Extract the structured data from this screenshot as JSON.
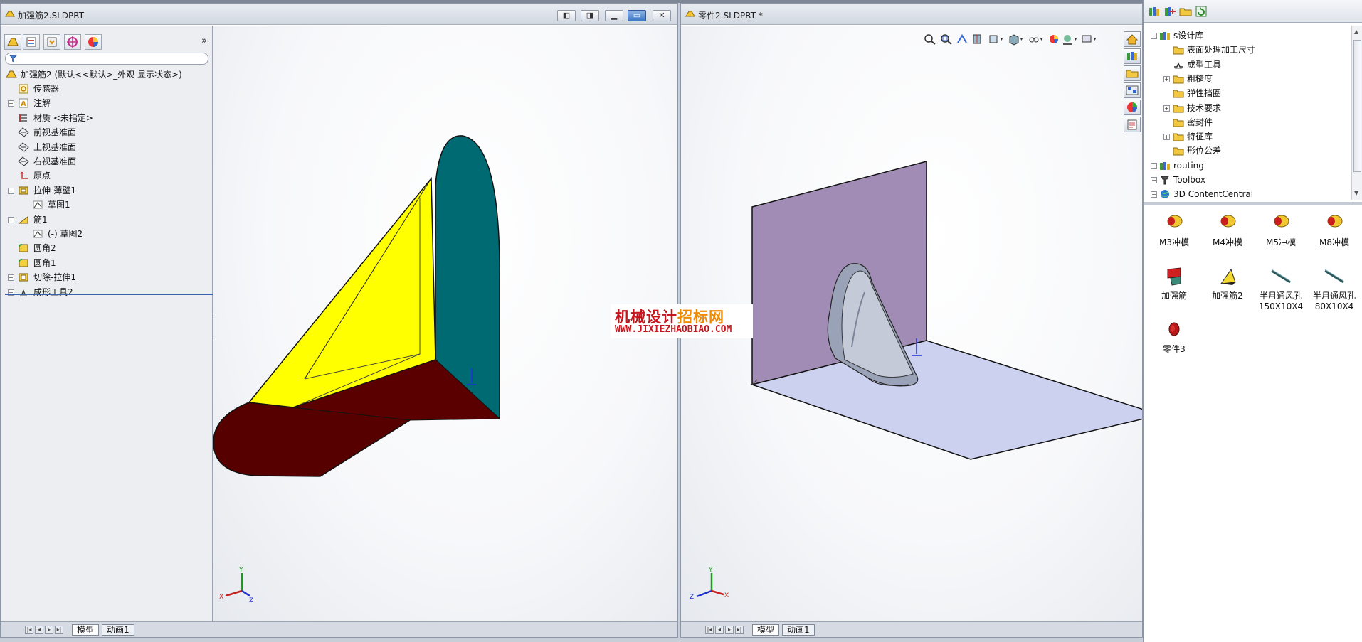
{
  "left_window": {
    "title": "加强筋2.SLDPRT",
    "feature_tree": {
      "root": "加强筋2 (默认<<默认>_外观 显示状态>)",
      "items": [
        {
          "label": "传感器",
          "icon": "sensor-icon",
          "expand": ""
        },
        {
          "label": "注解",
          "icon": "annotation-icon",
          "expand": "+"
        },
        {
          "label": "材质 <未指定>",
          "icon": "material-icon",
          "expand": ""
        },
        {
          "label": "前视基准面",
          "icon": "plane-icon",
          "expand": ""
        },
        {
          "label": "上视基准面",
          "icon": "plane-icon",
          "expand": ""
        },
        {
          "label": "右视基准面",
          "icon": "plane-icon",
          "expand": ""
        },
        {
          "label": "原点",
          "icon": "origin-icon",
          "expand": ""
        },
        {
          "label": "拉伸-薄壁1",
          "icon": "extrude-icon",
          "expand": "-"
        },
        {
          "label": "草图1",
          "icon": "sketch-icon",
          "expand": ""
        },
        {
          "label": "筋1",
          "icon": "rib-icon",
          "expand": "-"
        },
        {
          "label": "(-) 草图2",
          "icon": "sketch-icon",
          "expand": ""
        },
        {
          "label": "圆角2",
          "icon": "fillet-icon",
          "expand": ""
        },
        {
          "label": "圆角1",
          "icon": "fillet-icon",
          "expand": ""
        },
        {
          "label": "切除-拉伸1",
          "icon": "cut-icon",
          "expand": "+"
        },
        {
          "label": "成形工具2",
          "icon": "forming-tool-icon",
          "expand": "+"
        }
      ]
    },
    "tabs": [
      "模型",
      "动画1"
    ]
  },
  "right_window": {
    "title": "零件2.SLDPRT *",
    "tabs": [
      "模型",
      "动画1"
    ]
  },
  "task_pane": {
    "tree": [
      {
        "label": "s设计库",
        "icon": "design-library-icon",
        "expand": "-"
      },
      {
        "label": "表面处理加工尺寸",
        "icon": "folder-icon",
        "expand": ""
      },
      {
        "label": "成型工具",
        "icon": "forming-tool-icon",
        "expand": ""
      },
      {
        "label": "粗糙度",
        "icon": "folder-icon",
        "expand": "+"
      },
      {
        "label": "弹性挡圈",
        "icon": "folder-icon",
        "expand": ""
      },
      {
        "label": "技术要求",
        "icon": "folder-icon",
        "expand": "+"
      },
      {
        "label": "密封件",
        "icon": "folder-icon",
        "expand": ""
      },
      {
        "label": "特征库",
        "icon": "folder-icon",
        "expand": "+"
      },
      {
        "label": "形位公差",
        "icon": "folder-icon",
        "expand": ""
      },
      {
        "label": "routing",
        "icon": "design-library-icon",
        "expand": "+"
      },
      {
        "label": "Toolbox",
        "icon": "toolbox-icon",
        "expand": "+"
      },
      {
        "label": "3D ContentCentral",
        "icon": "globe-icon",
        "expand": "+"
      }
    ],
    "palette": [
      {
        "label": "M3冲模",
        "icon": "die-icon"
      },
      {
        "label": "M4冲模",
        "icon": "die-icon"
      },
      {
        "label": "M5冲模",
        "icon": "die-icon"
      },
      {
        "label": "M8冲模",
        "icon": "die-icon"
      },
      {
        "label": "加强筋",
        "icon": "rib-part-icon"
      },
      {
        "label": "加强筋2",
        "icon": "rib2-part-icon"
      },
      {
        "label": "半月通风孔\n150X10X4",
        "icon": "louver-icon"
      },
      {
        "label": "半月通风孔\n80X10X4",
        "icon": "louver-icon"
      },
      {
        "label": "零件3",
        "icon": "part-icon"
      }
    ]
  },
  "watermark": {
    "cn_part1": "机械设计",
    "cn_part2": "招标网",
    "en": "WWW.JIXIEZHAOBIAO.COM"
  },
  "triad": {
    "x": "X",
    "y": "Y",
    "z": "Z"
  },
  "colors": {
    "rib_face": "#ffff00",
    "wall_face": "#006a73",
    "base_face": "#560000",
    "plate_vertical": "#a08cb4",
    "plate_horizontal": "#cdd1f0"
  }
}
